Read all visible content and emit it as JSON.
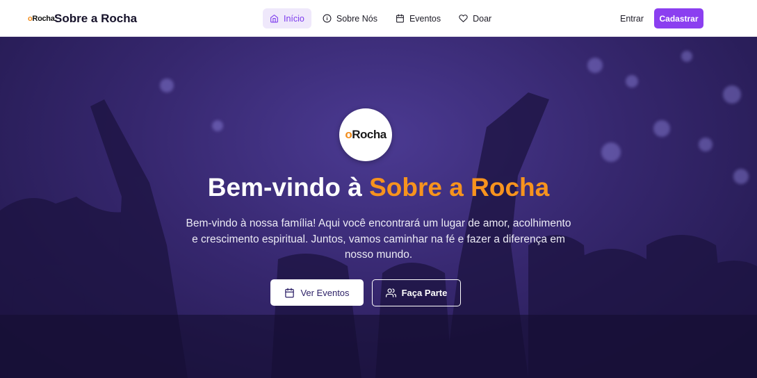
{
  "header": {
    "brand_mark": "Rocha",
    "brand_name": "Sobre a Rocha",
    "nav": [
      {
        "label": "Início",
        "icon": "home-icon",
        "active": true
      },
      {
        "label": "Sobre Nós",
        "icon": "info-icon",
        "active": false
      },
      {
        "label": "Eventos",
        "icon": "calendar-icon",
        "active": false
      },
      {
        "label": "Doar",
        "icon": "heart-icon",
        "active": false
      }
    ],
    "login_label": "Entrar",
    "signup_label": "Cadastrar"
  },
  "hero": {
    "logo_mark": "Rocha",
    "title_prefix": "Bem-vindo à ",
    "title_accent": "Sobre a Rocha",
    "text": "Bem-vindo à nossa família! Aqui você encontrará um lugar de amor, acolhimento e crescimento espiritual. Juntos, vamos caminhar na fé e fazer a diferença em nosso mundo.",
    "primary_button": "Ver Eventos",
    "secondary_button": "Faça Parte"
  },
  "colors": {
    "accent": "#8b3ff0",
    "highlight": "#f7931e",
    "hero_bg": "#36276e"
  }
}
